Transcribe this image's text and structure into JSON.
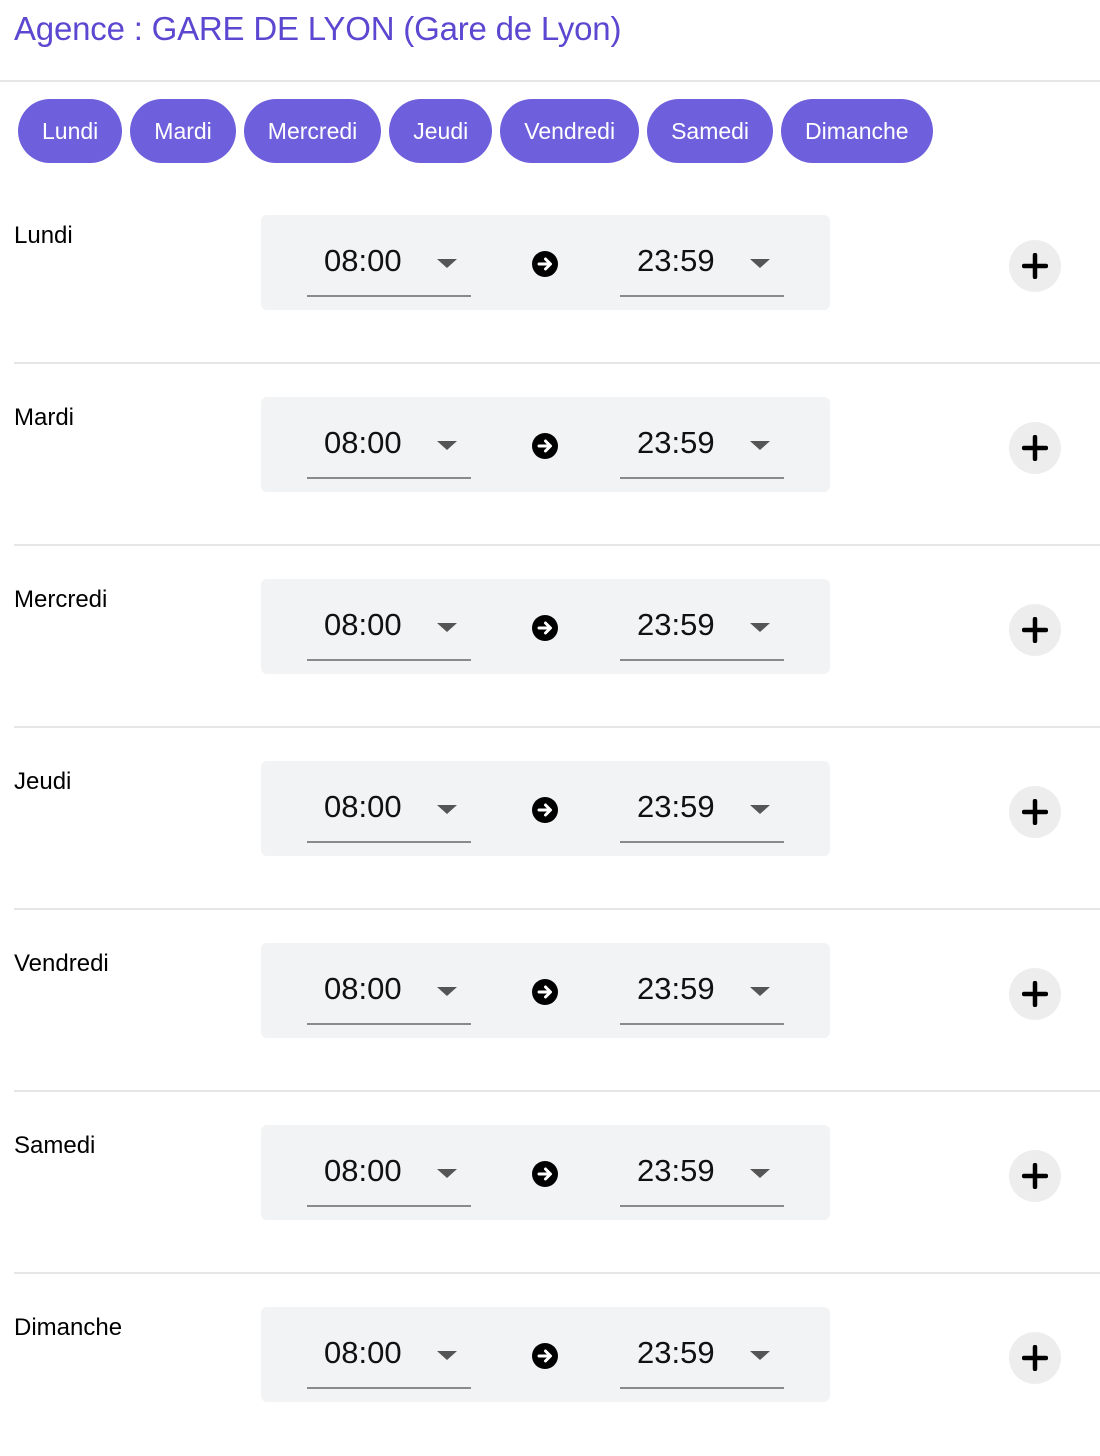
{
  "header": {
    "title": "Agence : GARE DE LYON (Gare de Lyon)"
  },
  "tabs": [
    {
      "label": "Lundi"
    },
    {
      "label": "Mardi"
    },
    {
      "label": "Mercredi"
    },
    {
      "label": "Jeudi"
    },
    {
      "label": "Vendredi"
    },
    {
      "label": "Samedi"
    },
    {
      "label": "Dimanche"
    }
  ],
  "schedule": [
    {
      "day": "Lundi",
      "start": "08:00",
      "end": "23:59"
    },
    {
      "day": "Mardi",
      "start": "08:00",
      "end": "23:59"
    },
    {
      "day": "Mercredi",
      "start": "08:00",
      "end": "23:59"
    },
    {
      "day": "Jeudi",
      "start": "08:00",
      "end": "23:59"
    },
    {
      "day": "Vendredi",
      "start": "08:00",
      "end": "23:59"
    },
    {
      "day": "Samedi",
      "start": "08:00",
      "end": "23:59"
    },
    {
      "day": "Dimanche",
      "start": "08:00",
      "end": "23:59"
    }
  ],
  "icons": {
    "separator": "arrow-right-circle-icon",
    "add": "plus-icon",
    "dropdown": "caret-down-icon"
  },
  "colors": {
    "accent": "#5b47d0",
    "tab_background": "#6e5fdc",
    "slot_background": "#f2f3f5"
  }
}
